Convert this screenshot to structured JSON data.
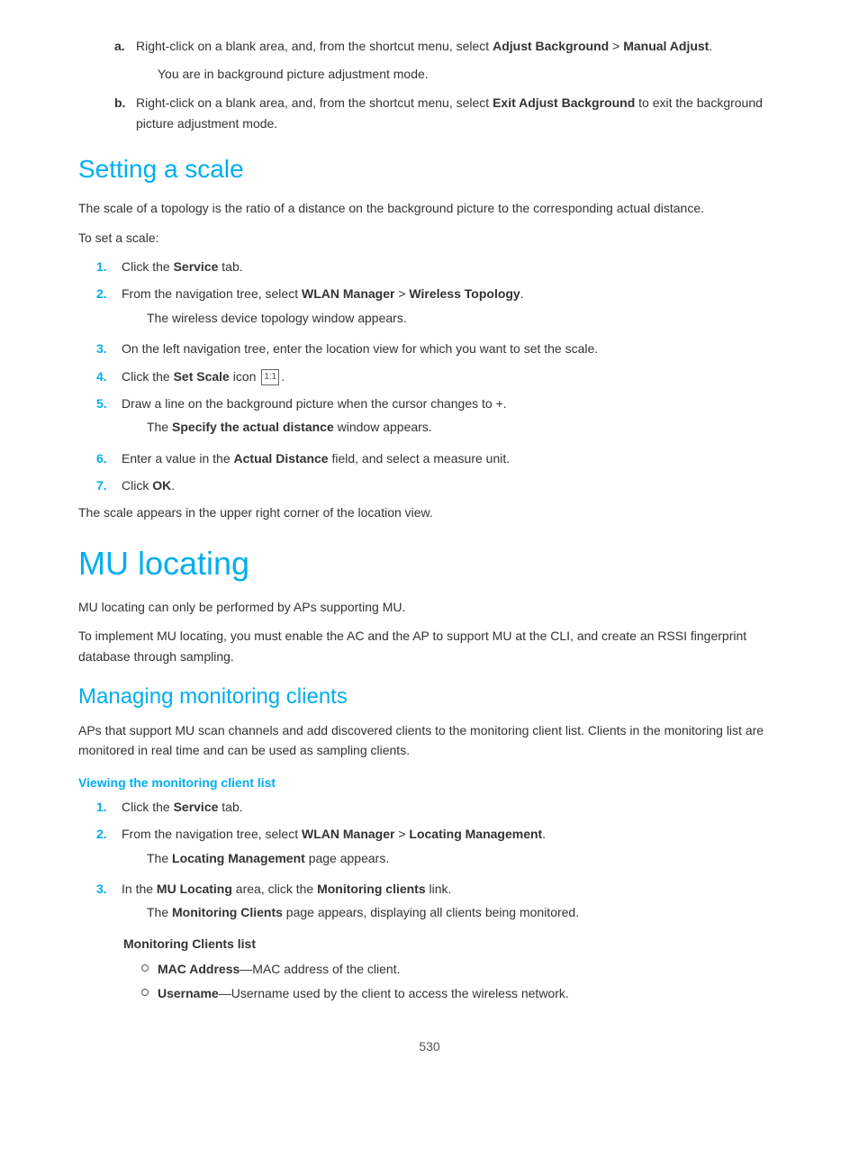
{
  "top_steps": {
    "step_a": {
      "label": "a.",
      "text_before": "Right-click on a blank area, and, from the shortcut menu, select ",
      "bold1": "Adjust Background",
      "text_mid": " > ",
      "bold2": "Manual Adjust",
      "text_end": "."
    },
    "step_a_note": "You are in background picture adjustment mode.",
    "step_b": {
      "label": "b.",
      "text_before": "Right-click on a blank area, and, from the shortcut menu, select ",
      "bold1": "Exit Adjust Background",
      "text_end": " to exit the background picture adjustment mode."
    }
  },
  "setting_scale": {
    "title": "Setting a scale",
    "body1": "The scale of a topology is the ratio of a distance on the background picture to the corresponding actual distance.",
    "body2": "To set a scale:",
    "steps": [
      {
        "num": "1.",
        "text_before": "Click the ",
        "bold": "Service",
        "text_after": " tab."
      },
      {
        "num": "2.",
        "text_before": "From the navigation tree, select ",
        "bold1": "WLAN Manager",
        "text_mid": " > ",
        "bold2": "Wireless Topology",
        "text_after": ".",
        "note": "The wireless device topology window appears."
      },
      {
        "num": "3.",
        "text": "On the left navigation tree, enter the location view for which you want to set the scale."
      },
      {
        "num": "4.",
        "text_before": "Click the ",
        "bold": "Set Scale",
        "text_after": " icon ",
        "icon": "1:1",
        "text_end": "."
      },
      {
        "num": "5.",
        "text_before": "Draw a line on the background picture when the cursor changes to +.",
        "note_before": "The ",
        "note_bold": "Specify the actual distance",
        "note_after": " window appears."
      },
      {
        "num": "6.",
        "text_before": "Enter a value in the ",
        "bold": "Actual Distance",
        "text_after": " field, and select a measure unit."
      },
      {
        "num": "7.",
        "text_before": "Click ",
        "bold": "OK",
        "text_after": "."
      }
    ],
    "footer": "The scale appears in the upper right corner of the location view."
  },
  "mu_locating": {
    "title": "MU locating",
    "body1": "MU locating can only be performed by APs supporting MU.",
    "body2": "To implement MU locating, you must enable the AC and the AP to support MU at the CLI, and create an RSSI fingerprint database through sampling."
  },
  "managing_clients": {
    "title": "Managing monitoring clients",
    "body1": "APs that support MU scan channels and add discovered clients to the monitoring client list. Clients in the monitoring list are monitored in real time and can be used as sampling clients.",
    "sub_section": {
      "title": "Viewing the monitoring client list",
      "steps": [
        {
          "num": "1.",
          "text_before": "Click the ",
          "bold": "Service",
          "text_after": " tab."
        },
        {
          "num": "2.",
          "text_before": "From the navigation tree, select ",
          "bold1": "WLAN Manager",
          "text_mid": " > ",
          "bold2": "Locating Management",
          "text_after": ".",
          "note_before": "The ",
          "note_bold": "Locating Management",
          "note_after": " page appears."
        },
        {
          "num": "3.",
          "text_before": "In the ",
          "bold1": "MU Locating",
          "text_mid": " area, click the ",
          "bold2": "Monitoring clients",
          "text_after": " link.",
          "note_before": "The ",
          "note_bold": "Monitoring Clients",
          "note_after": " page appears, displaying all clients being monitored."
        }
      ],
      "list_title": "Monitoring Clients list",
      "list_items": [
        {
          "bold": "MAC Address",
          "text": "—MAC address of the client."
        },
        {
          "bold": "Username",
          "text": "—Username used by the client to access the wireless network."
        }
      ]
    }
  },
  "page_number": "530"
}
